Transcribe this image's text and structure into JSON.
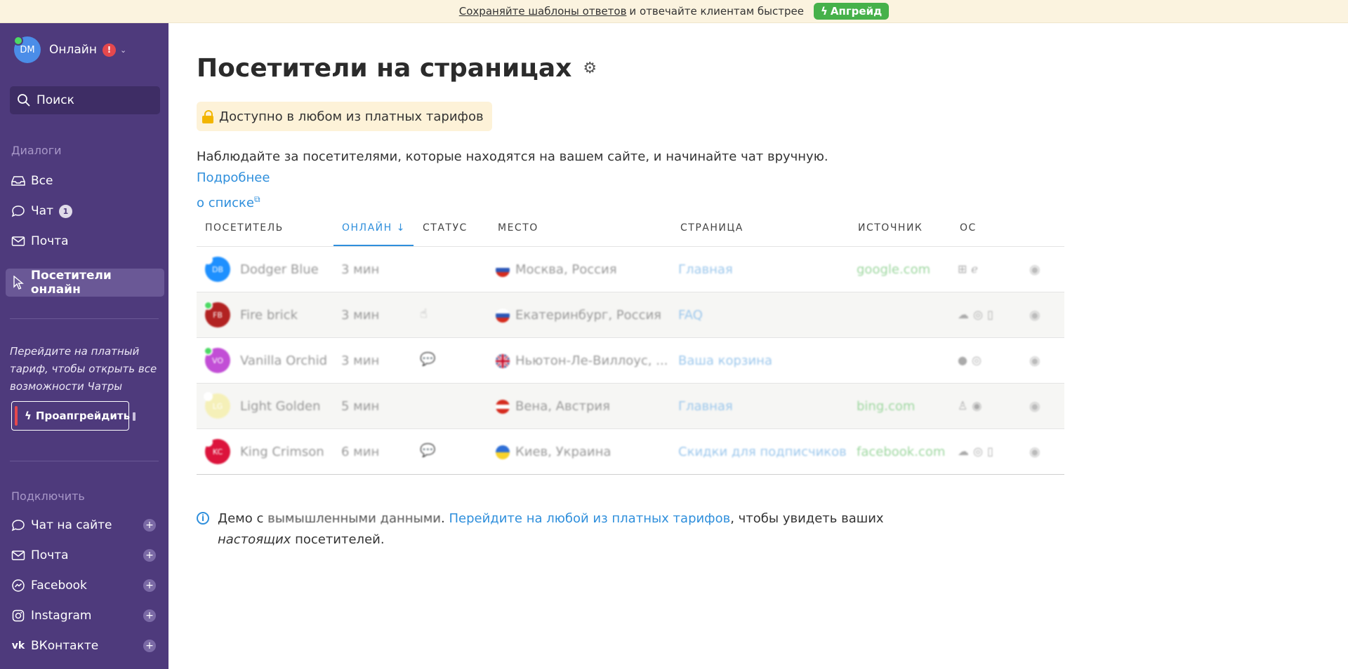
{
  "banner": {
    "link_text": "Сохраняйте шаблоны ответов",
    "text": "и отвечайте клиентам быстрее",
    "upgrade_label": "Апгрейд"
  },
  "sidebar": {
    "avatar_initials": "DM",
    "status_label": "Онлайн",
    "alert_badge": "!",
    "search_placeholder": "Поиск",
    "dialogs_title": "Диалоги",
    "dialogs": [
      {
        "label": "Все",
        "icon": "inbox-icon"
      },
      {
        "label": "Чат",
        "icon": "chat-icon",
        "count": "1"
      },
      {
        "label": "Почта",
        "icon": "mail-icon"
      }
    ],
    "active_item": "Посетители онлайн",
    "promo_text": "Перейдите на платный тариф, чтобы открыть все возможности Чатры",
    "promo_button": "Проапгрейдить",
    "connect_title": "Подключить",
    "connect": [
      {
        "label": "Чат на сайте",
        "icon": "chat-icon"
      },
      {
        "label": "Почта",
        "icon": "mail-icon"
      },
      {
        "label": "Facebook",
        "icon": "messenger-icon"
      },
      {
        "label": "Instagram",
        "icon": "instagram-icon"
      },
      {
        "label": "ВКонтакте",
        "icon": "vk-icon"
      }
    ],
    "plus": "+"
  },
  "main": {
    "title": "Посетители на страницах",
    "notice": "Доступно в любом из платных тарифов",
    "description": "Наблюдайте за посетителями, которые находятся на вашем сайте, и начинайте чат вручную.",
    "description_link_1": "Подробнее",
    "description_link_2": "о списке",
    "columns": [
      "ПОСЕТИТЕЛЬ",
      "ОНЛАЙН",
      "СТАТУС",
      "МЕСТО",
      "СТРАНИЦА",
      "ИСТОЧНИК",
      "ОС"
    ],
    "sort_arrow": "↓",
    "rows": [
      {
        "initials": "DB",
        "name": "Dodger Blue",
        "time": "3 мин",
        "status": "",
        "place": "Москва, Россия",
        "flag": "ru",
        "page": "Главная",
        "source": "google.com",
        "os": [
          "windows-icon",
          "ie-icon"
        ],
        "avatar_color": "#1e90ff",
        "online_color": "#ffffff"
      },
      {
        "initials": "FB",
        "name": "Fire brick",
        "time": "3 мин",
        "status": "☝",
        "place": "Екатеринбург, Россия",
        "flag": "ru",
        "page": "FAQ",
        "source": "",
        "os": [
          "android-icon",
          "chrome-icon",
          "mobile-icon"
        ],
        "avatar_color": "#b22222",
        "online_color": "#4cd964"
      },
      {
        "initials": "VO",
        "name": "Vanilla Orchid",
        "time": "3 мин",
        "status": "💬",
        "place": "Ньютон-Ле-Виллоус, ...",
        "flag": "gb",
        "page": "Ваша корзина",
        "source": "",
        "os": [
          "apple-icon",
          "chrome-icon"
        ],
        "avatar_color": "#c24ed6",
        "online_color": "#4cd964"
      },
      {
        "initials": "LG",
        "name": "Light Golden",
        "time": "5 мин",
        "status": "",
        "place": "Вена, Австрия",
        "flag": "at",
        "page": "Главная",
        "source": "bing.com",
        "os": [
          "linux-icon",
          "firefox-icon"
        ],
        "avatar_color": "#f5f0b8",
        "online_color": "#ffffff"
      },
      {
        "initials": "KC",
        "name": "King Crimson",
        "time": "6 мин",
        "status": "💬",
        "place": "Киев, Украина",
        "flag": "ua",
        "page": "Скидки для подписчиков",
        "source": "facebook.com",
        "os": [
          "android-icon",
          "chrome-icon",
          "mobile-icon"
        ],
        "avatar_color": "#dc143c",
        "online_color": "#ffffff"
      }
    ],
    "demo_prefix": "Демо с",
    "demo_blurred": "вымышленными данными",
    "demo_link": "Перейдите на любой из платных тарифов",
    "demo_suffix": ", чтобы увидеть ваших",
    "demo_italic": "настоящих",
    "demo_end": "посетителей."
  },
  "colors": {
    "sidebar_bg": "#4e3a7c",
    "accent_blue": "#2f8fdc",
    "upgrade_green": "#46b14a",
    "banner_bg": "#fbf3df"
  }
}
